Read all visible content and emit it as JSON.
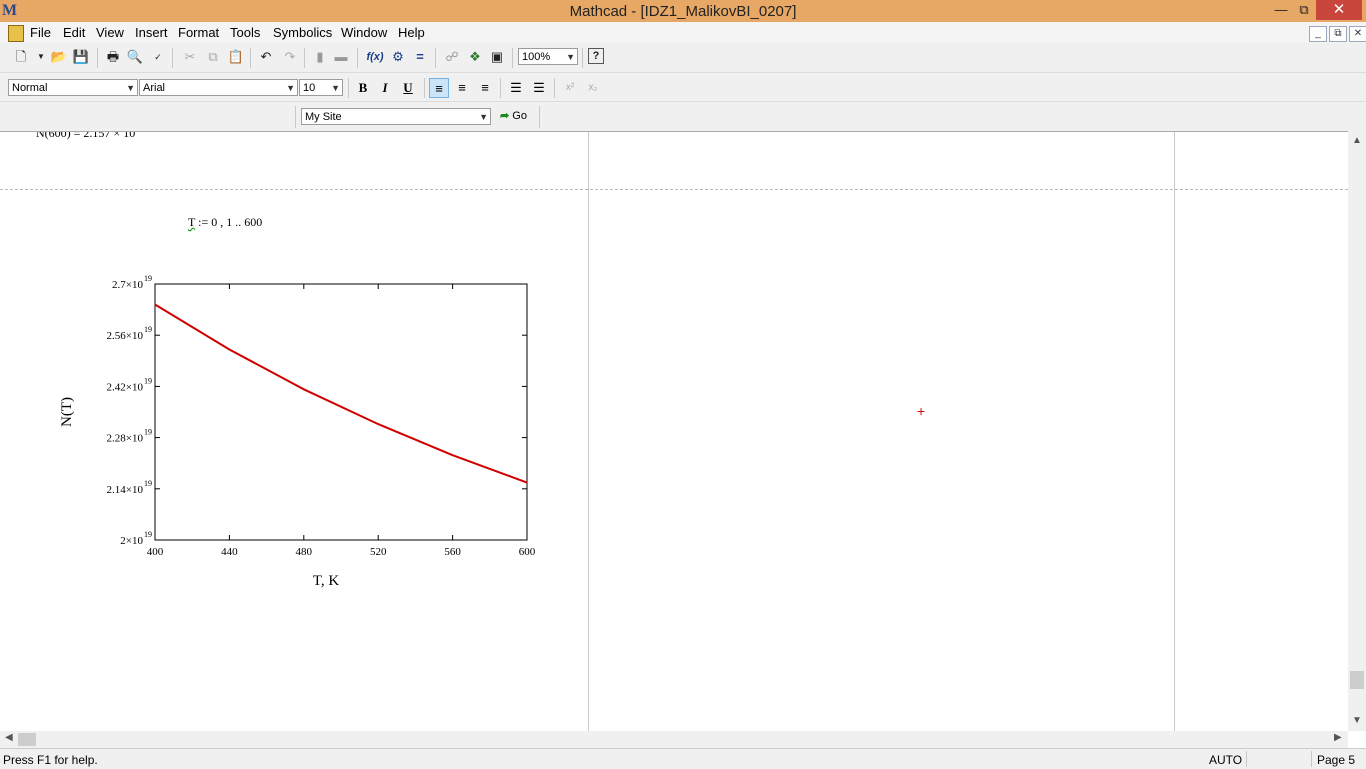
{
  "window": {
    "title": "Mathcad - [IDZ1_MalikovBI_0207]",
    "logo": "M"
  },
  "menu": [
    "File",
    "Edit",
    "View",
    "Insert",
    "Format",
    "Tools",
    "Symbolics",
    "Window",
    "Help"
  ],
  "toolbar": {
    "zoom": "100%"
  },
  "format_bar": {
    "style": "Normal",
    "font": "Arial",
    "size": "10",
    "bold": "B",
    "italic": "I",
    "underline": "U"
  },
  "web_bar": {
    "site": "My Site",
    "go": "Go"
  },
  "worksheet": {
    "partial_result": {
      "lhs": "N(600) = 2.157 × 10"
    },
    "range_def": {
      "var": "T",
      "expr": ":= 0 , 1 .. 600"
    }
  },
  "chart_data": {
    "type": "line",
    "xlabel": "T, K",
    "ylabel": "N(T)",
    "xlim": [
      400,
      600
    ],
    "ylim": [
      2e+19,
      2.7e+19
    ],
    "x_ticks": [
      {
        "v": 400,
        "label": "400"
      },
      {
        "v": 440,
        "label": "440"
      },
      {
        "v": 480,
        "label": "480"
      },
      {
        "v": 520,
        "label": "520"
      },
      {
        "v": 560,
        "label": "560"
      },
      {
        "v": 600,
        "label": "600"
      }
    ],
    "y_ticks": [
      {
        "v": 2e+19,
        "mant": "2",
        "exp": "19"
      },
      {
        "v": 2.14e+19,
        "mant": "2.14",
        "exp": "19"
      },
      {
        "v": 2.28e+19,
        "mant": "2.28",
        "exp": "19"
      },
      {
        "v": 2.42e+19,
        "mant": "2.42",
        "exp": "19"
      },
      {
        "v": 2.56e+19,
        "mant": "2.56",
        "exp": "19"
      },
      {
        "v": 2.7e+19,
        "mant": "2.7",
        "exp": "19"
      }
    ],
    "series": [
      {
        "color": "#d00000",
        "x": [
          400,
          440,
          480,
          520,
          560,
          600
        ],
        "y": [
          2.644e+19,
          2.521e+19,
          2.412e+19,
          2.317e+19,
          2.232e+19,
          2.157e+19
        ]
      }
    ]
  },
  "status": {
    "help": "Press F1 for help.",
    "mode": "AUTO",
    "page": "Page 5"
  }
}
